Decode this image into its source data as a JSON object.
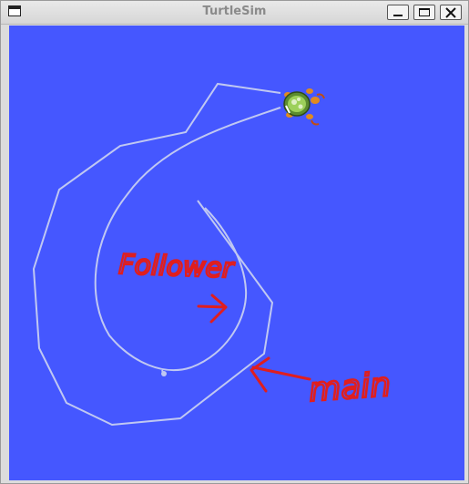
{
  "window": {
    "title": "TurtleSim",
    "buttons": {
      "menu": "window-menu-icon",
      "minimize": "minimize-icon",
      "maximize": "maximize-icon",
      "close": "close-icon"
    }
  },
  "canvas": {
    "background_color": "#4557ff",
    "trail_color": "#c0c8f2",
    "annotation_color": "#e01e1e"
  },
  "annotations": {
    "follower": "Follower",
    "main": "main"
  },
  "turtle": {
    "icon": "turtle-icon"
  }
}
